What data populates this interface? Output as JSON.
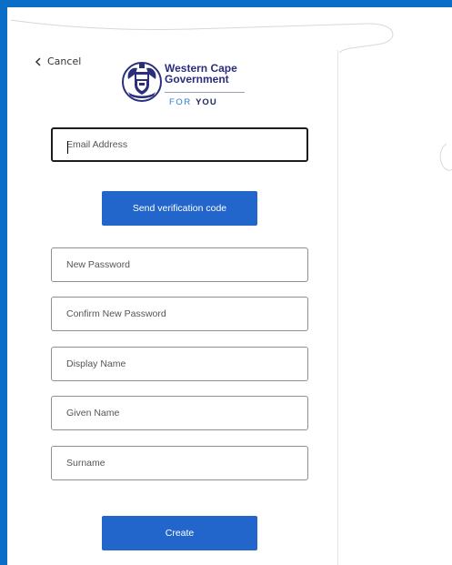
{
  "nav": {
    "cancel_label": "Cancel"
  },
  "brand": {
    "line1": "Western Cape",
    "line2": "Government",
    "tag_prefix": "FOR ",
    "tag_bold": "YOU"
  },
  "form": {
    "email_placeholder": "Email Address",
    "send_code_label": "Send verification code",
    "new_password_placeholder": "New Password",
    "confirm_password_placeholder": "Confirm New Password",
    "display_name_placeholder": "Display Name",
    "given_name_placeholder": "Given Name",
    "surname_placeholder": "Surname",
    "create_label": "Create"
  },
  "colors": {
    "frame": "#0a6ec6",
    "button": "#2266cc",
    "brand_navy": "#2a2e7c",
    "brand_blue": "#2a7dd1"
  }
}
